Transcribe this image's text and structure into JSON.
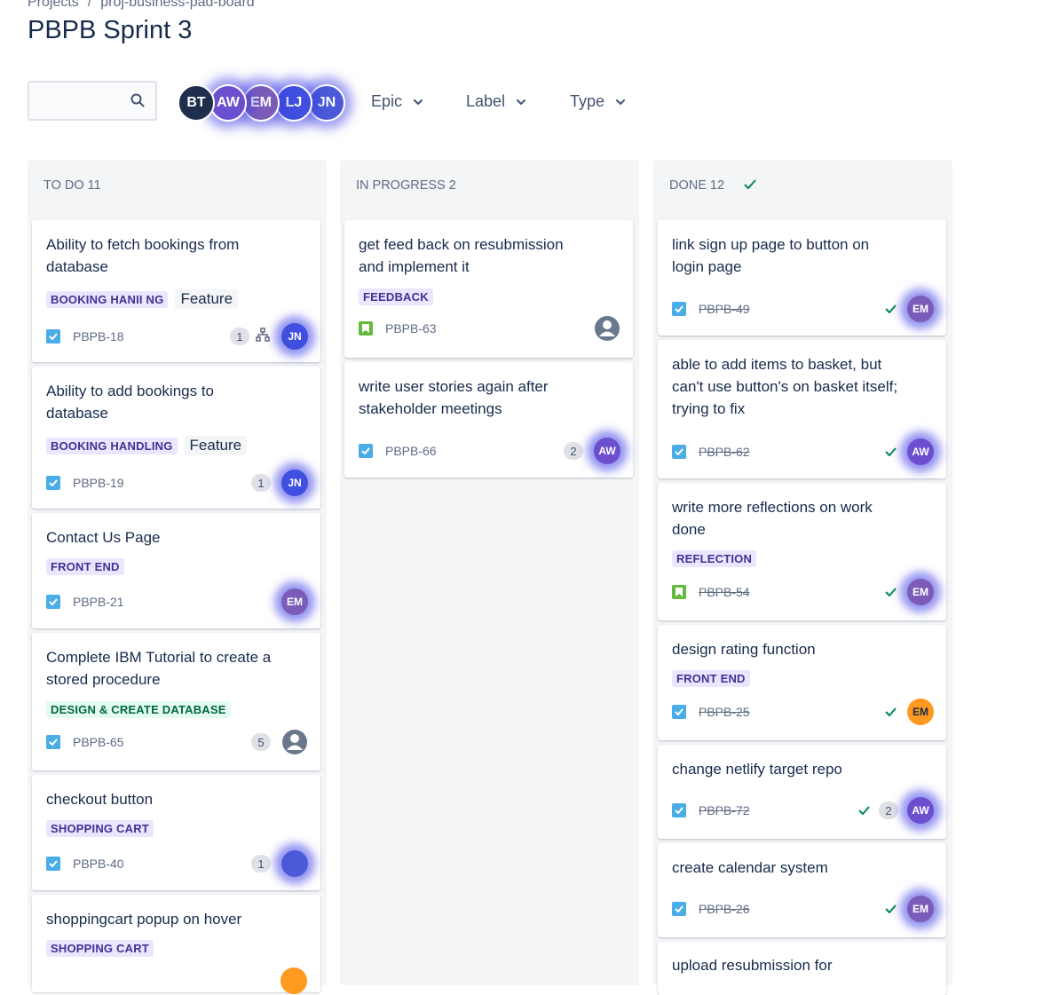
{
  "breadcrumb": {
    "root": "Projects",
    "sep": "/",
    "project": "proj-business-pad-board"
  },
  "page": {
    "title": "PBPB Sprint 3"
  },
  "search": {
    "placeholder": ""
  },
  "avatars": [
    {
      "initials": "BT",
      "color": "#1e2e4c"
    },
    {
      "initials": "AW",
      "color": "#6b4fcf"
    },
    {
      "initials": "EM",
      "color": "#7b5cb8"
    },
    {
      "initials": "LJ",
      "color": "#3f4fdf"
    },
    {
      "initials": "JN",
      "color": "#4a5ad8"
    }
  ],
  "filters": {
    "epic": "Epic",
    "label": "Label",
    "type": "Type"
  },
  "colors": {
    "accent": "#0052cc",
    "done_check": "#00875a",
    "task": "#4bade8",
    "story": "#63ba3c",
    "avatar_em": "#ff991f"
  },
  "columns": {
    "todo": {
      "title": "TO DO 11"
    },
    "inprogress": {
      "title": "IN PROGRESS 2"
    },
    "done": {
      "title": "DONE 12"
    }
  },
  "cards": {
    "todo": [
      {
        "title": "Ability to fetch bookings from database",
        "label": "BOOKING HANıı NG",
        "tag": "Feature",
        "key": "PBPB-18",
        "estimate": "1",
        "avatar": "JN"
      },
      {
        "title": "Ability to add bookings to database",
        "label": "BOOKING HANDLING",
        "tag": "Feature",
        "key": "PBPB-19",
        "estimate": "1",
        "avatar": "JN"
      },
      {
        "title": "Contact Us Page",
        "label": "FRONT END",
        "key": "PBPB-21",
        "avatar": "EM"
      },
      {
        "title": "Complete IBM Tutorial to create a stored procedure",
        "label": "DESIGN & CREATE DATABASE",
        "key": "PBPB-65",
        "estimate": "5"
      },
      {
        "title": "checkout button",
        "label": "SHOPPING CART",
        "key": "PBPB-40",
        "estimate": "1"
      },
      {
        "title": "shoppingcart popup on hover",
        "label": "SHOPPING CART"
      }
    ],
    "inprogress": [
      {
        "title": "get feed back on resubmission and implement it",
        "label": "FEEDBACK",
        "key": "PBPB-63"
      },
      {
        "title": "write user stories again after stakeholder meetings",
        "key": "PBPB-66",
        "estimate": "2",
        "avatar": "AW"
      }
    ],
    "done": [
      {
        "title": "link sign up page to button on login page",
        "key": "PBPB-49",
        "avatar": "EM"
      },
      {
        "title": "able to add items to basket, but can't use button's on basket itself; trying to fix",
        "key": "PBPB-62",
        "avatar": "AW"
      },
      {
        "title": "write more reflections on work done",
        "label": "REFLECTION",
        "key": "PBPB-54",
        "avatar": "EM"
      },
      {
        "title": "design rating function",
        "label": "FRONT END",
        "key": "PBPB-25",
        "avatar": "EM"
      },
      {
        "title": "change netlify target repo",
        "key": "PBPB-72",
        "estimate": "2",
        "avatar": "AW"
      },
      {
        "title": "create calendar system",
        "key": "PBPB-26",
        "avatar": "EM"
      },
      {
        "title": "upload resubmission for"
      }
    ]
  }
}
